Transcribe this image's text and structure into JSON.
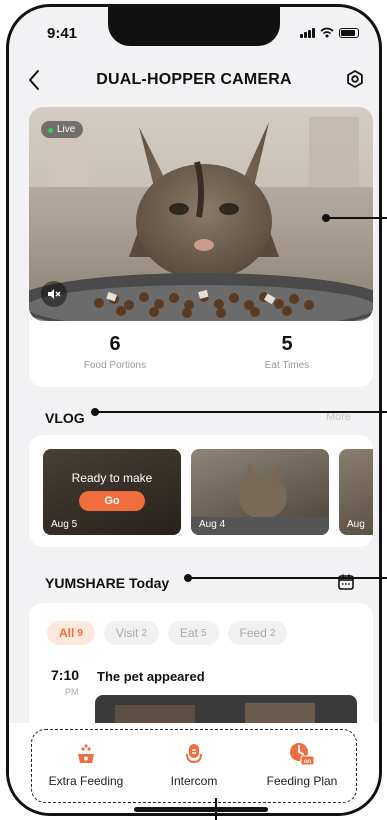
{
  "status_bar": {
    "time": "9:41"
  },
  "header": {
    "title": "DUAL-HOPPER CAMERA",
    "back_icon": "chevron-left-icon",
    "settings_icon": "settings-icon"
  },
  "camera": {
    "live_label": "Live",
    "stats": [
      {
        "value": "6",
        "label": "Food Portions"
      },
      {
        "value": "5",
        "label": "Eat Times"
      }
    ]
  },
  "vlog": {
    "title": "VLOG",
    "more_label": "More",
    "items": [
      {
        "date": "Aug 5",
        "overlay": "Ready to make",
        "button": "Go"
      },
      {
        "date": "Aug 4"
      },
      {
        "date": "Aug"
      }
    ]
  },
  "yumshare": {
    "title": "YUMSHARE Today",
    "filters": [
      {
        "label": "All",
        "count": "9",
        "active": true
      },
      {
        "label": "Visit",
        "count": "2",
        "active": false
      },
      {
        "label": "Eat",
        "count": "5",
        "active": false
      },
      {
        "label": "Feed",
        "count": "2",
        "active": false
      }
    ],
    "event": {
      "time": "7:10",
      "period": "PM",
      "title": "The pet appeared"
    }
  },
  "bottom_actions": [
    {
      "label": "Extra Feeding",
      "icon": "extra-feeding-icon"
    },
    {
      "label": "Intercom",
      "icon": "microphone-icon"
    },
    {
      "label": "Feeding Plan",
      "icon": "feeding-plan-icon"
    }
  ],
  "colors": {
    "accent": "#F26D3D",
    "background": "#F2F2F4",
    "card": "#FFFFFF",
    "text": "#111111",
    "muted": "#9A9A9A"
  }
}
